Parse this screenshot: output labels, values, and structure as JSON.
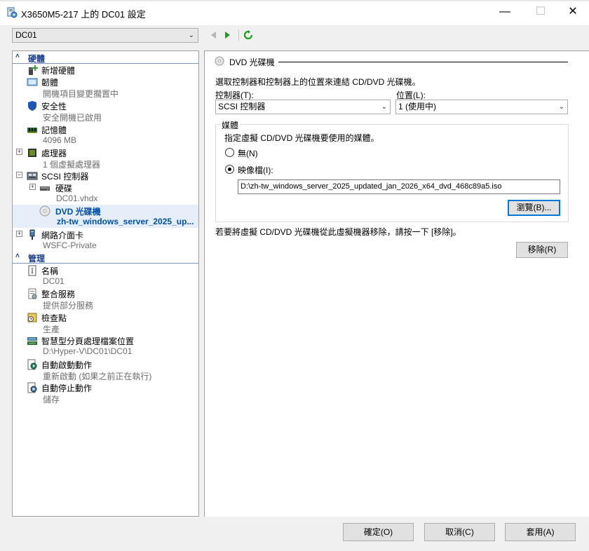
{
  "window": {
    "title": "X3650M5-217 上的 DC01 設定",
    "minimize": "—",
    "maximize": "☐",
    "close": "✕"
  },
  "vm_selector": {
    "value": "DC01"
  },
  "toolbar": {
    "back_icon": "back-arrow-icon",
    "forward_icon": "forward-arrow-icon",
    "refresh_icon": "refresh-icon"
  },
  "tree": {
    "hardware_header": "硬體",
    "management_header": "管理",
    "hardware": [
      {
        "label": "新增硬體",
        "sub": ""
      },
      {
        "label": "韌體",
        "sub": "開機項目變更擱置中"
      },
      {
        "label": "安全性",
        "sub": "安全開機已啟用"
      },
      {
        "label": "記憶體",
        "sub": "4096 MB"
      },
      {
        "label": "處理器",
        "sub": "1 個虛擬處理器"
      },
      {
        "label": "SCSI 控制器",
        "sub": ""
      },
      {
        "label": "硬碟",
        "sub": "DC01.vhdx"
      },
      {
        "label": "DVD 光碟機",
        "sub": "zh-tw_windows_server_2025_up..."
      },
      {
        "label": "網路介面卡",
        "sub": "WSFC-Private"
      }
    ],
    "management": [
      {
        "label": "名稱",
        "sub": "DC01"
      },
      {
        "label": "整合服務",
        "sub": "提供部分服務"
      },
      {
        "label": "檢查點",
        "sub": "生產"
      },
      {
        "label": "智慧型分頁處理檔案位置",
        "sub": "D:\\Hyper-V\\DC01\\DC01"
      },
      {
        "label": "自動啟動動作",
        "sub": "重新啟動 (如果之前正在執行)"
      },
      {
        "label": "自動停止動作",
        "sub": "儲存"
      }
    ]
  },
  "panel": {
    "title": "DVD 光碟機",
    "description": "選取控制器和控制器上的位置來連結 CD/DVD 光碟機。",
    "controller_label": "控制器(T):",
    "controller_value": "SCSI 控制器",
    "location_label": "位置(L):",
    "location_value": "1 (使用中)",
    "media_legend": "媒體",
    "media_prompt": "指定虛擬 CD/DVD 光碟機要使用的媒體。",
    "radio_none": "無(N)",
    "radio_image": "映像檔(I):",
    "image_path": "D:\\zh-tw_windows_server_2025_updated_jan_2026_x64_dvd_468c89a5.iso",
    "browse_label": "瀏覽(B)...",
    "remove_note": "若要將虛擬 CD/DVD 光碟機從此虛擬機器移除，請按一下 [移除]。",
    "remove_label": "移除(R)"
  },
  "footer": {
    "ok_label": "確定(O)",
    "cancel_label": "取消(C)",
    "apply_label": "套用(A)"
  }
}
